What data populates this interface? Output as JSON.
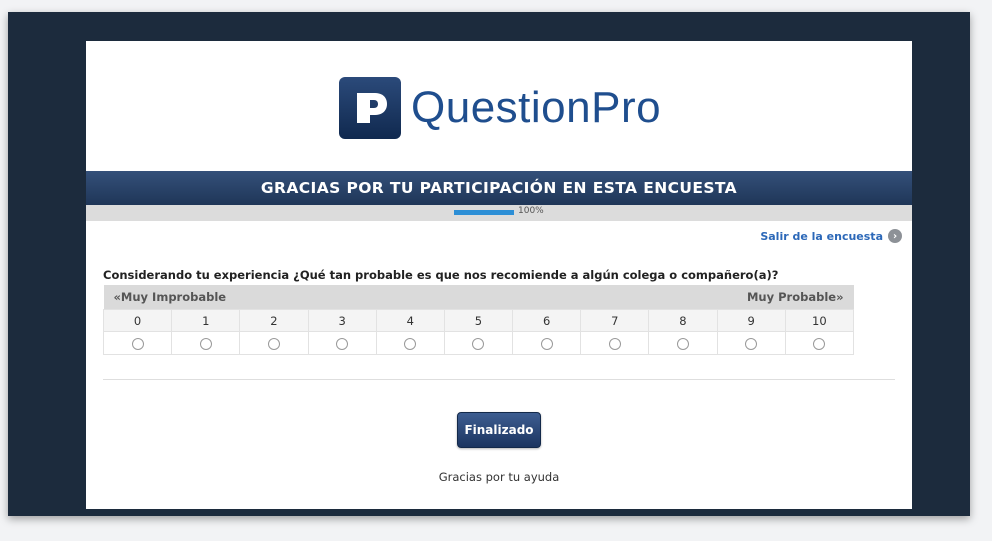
{
  "brand": {
    "name": "QuestionPro"
  },
  "banner": {
    "title": "GRACIAS POR TU PARTICIPACIÓN EN ESTA ENCUESTA"
  },
  "progress": {
    "percent": 100,
    "label": "100%"
  },
  "exit": {
    "label": "Salir de la encuesta",
    "icon": "chevron-right-circle-icon"
  },
  "question": {
    "text": "Considerando tu experiencia ¿Qué tan probable es que nos recomiende a algún colega o compañero(a)?",
    "left_anchor": "«Muy Improbable",
    "right_anchor": "Muy Probable»",
    "scale": [
      "0",
      "1",
      "2",
      "3",
      "4",
      "5",
      "6",
      "7",
      "8",
      "9",
      "10"
    ]
  },
  "actions": {
    "finish_label": "Finalizado"
  },
  "footer": {
    "thanks": "Gracias por tu ayuda"
  },
  "colors": {
    "brand_blue": "#1f4e8e",
    "banner": "#2a4470",
    "progress": "#2d8fd6",
    "link": "#2c68b8"
  }
}
